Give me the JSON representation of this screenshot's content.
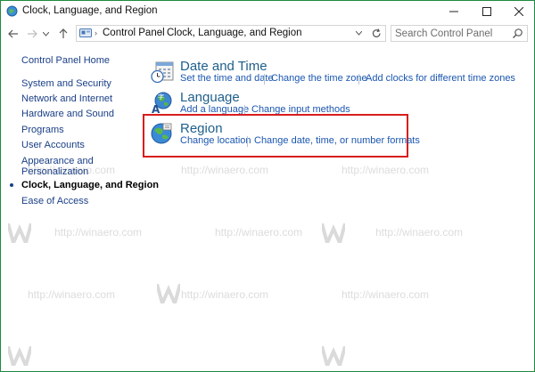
{
  "window": {
    "title": "Clock, Language, and Region",
    "controls": [
      "minimize",
      "maximize",
      "close"
    ]
  },
  "nav": {
    "back_icon": "back-arrow-icon",
    "forward_icon": "forward-arrow-icon",
    "recent_icon": "chevron-down-icon",
    "up_icon": "up-arrow-icon"
  },
  "address": {
    "crumbs": [
      "Control Panel",
      "Clock, Language, and Region"
    ],
    "refresh_icon": "refresh-icon"
  },
  "search": {
    "placeholder": "Search Control Panel",
    "icon": "search-icon"
  },
  "sidebar": {
    "items": [
      {
        "label": "Control Panel Home"
      },
      {
        "label": "System and Security"
      },
      {
        "label": "Network and Internet"
      },
      {
        "label": "Hardware and Sound"
      },
      {
        "label": "Programs"
      },
      {
        "label": "User Accounts"
      },
      {
        "label": "Appearance and",
        "label2": "Personalization"
      },
      {
        "label": "Clock, Language, and Region",
        "current": true
      },
      {
        "label": "Ease of Access"
      }
    ]
  },
  "categories": [
    {
      "title": "Date and Time",
      "icon": "clock-calendar-icon",
      "links": [
        "Set the time and date",
        "Change the time zone",
        "Add clocks for different time zones"
      ]
    },
    {
      "title": "Language",
      "icon": "language-globe-icon",
      "links": [
        "Add a language",
        "Change input methods"
      ]
    },
    {
      "title": "Region",
      "icon": "region-globe-icon",
      "links": [
        "Change location",
        "Change date, time, or number formats"
      ],
      "highlighted": true
    }
  ],
  "watermark": {
    "text": "http://winaero.com",
    "logo": "W"
  },
  "colors": {
    "link": "#1a56b0",
    "title": "#1e5f8b",
    "highlight": "#d81e1e",
    "border": "#1e8a3f"
  }
}
